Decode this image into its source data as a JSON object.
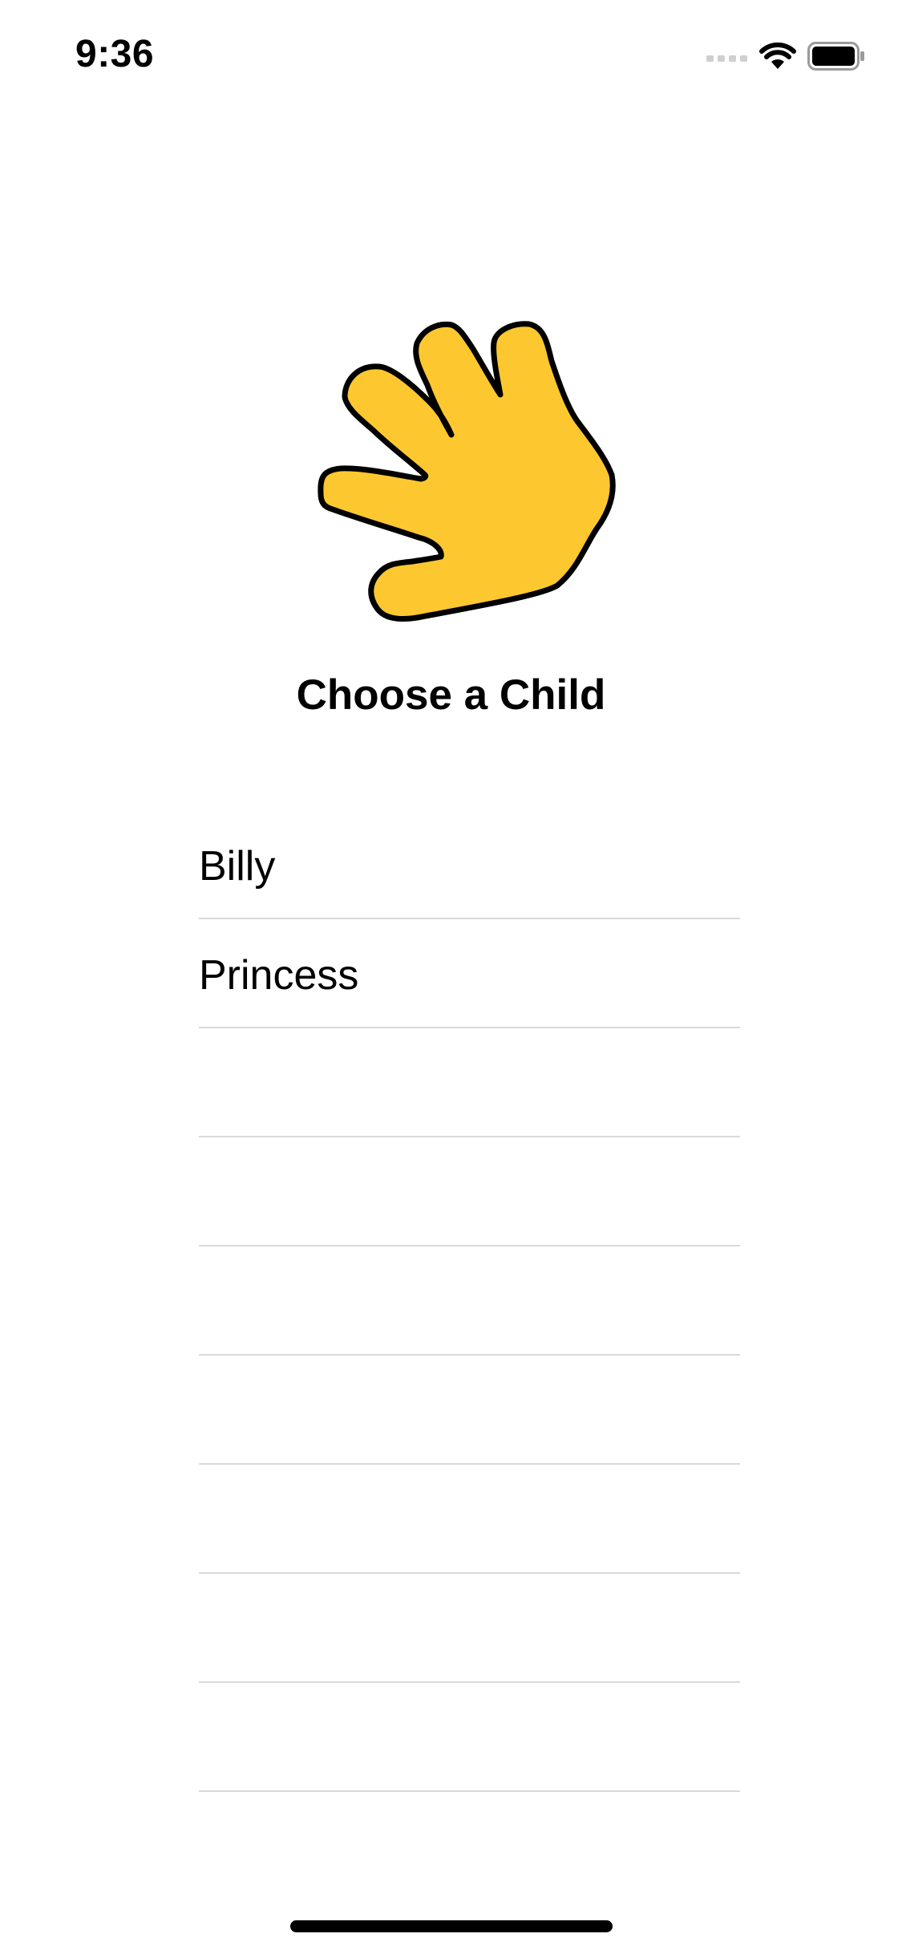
{
  "status_bar": {
    "time": "9:36",
    "icons": [
      "cellular-signal-icon",
      "wifi-icon",
      "battery-icon"
    ]
  },
  "logo": {
    "icon": "hand-icon",
    "fill_color": "#FDC82F",
    "stroke_color": "#000000"
  },
  "page": {
    "title": "Choose a Child"
  },
  "children": [
    {
      "name": "Billy"
    },
    {
      "name": "Princess"
    },
    {
      "name": ""
    },
    {
      "name": ""
    },
    {
      "name": ""
    },
    {
      "name": ""
    },
    {
      "name": ""
    },
    {
      "name": ""
    },
    {
      "name": ""
    }
  ]
}
